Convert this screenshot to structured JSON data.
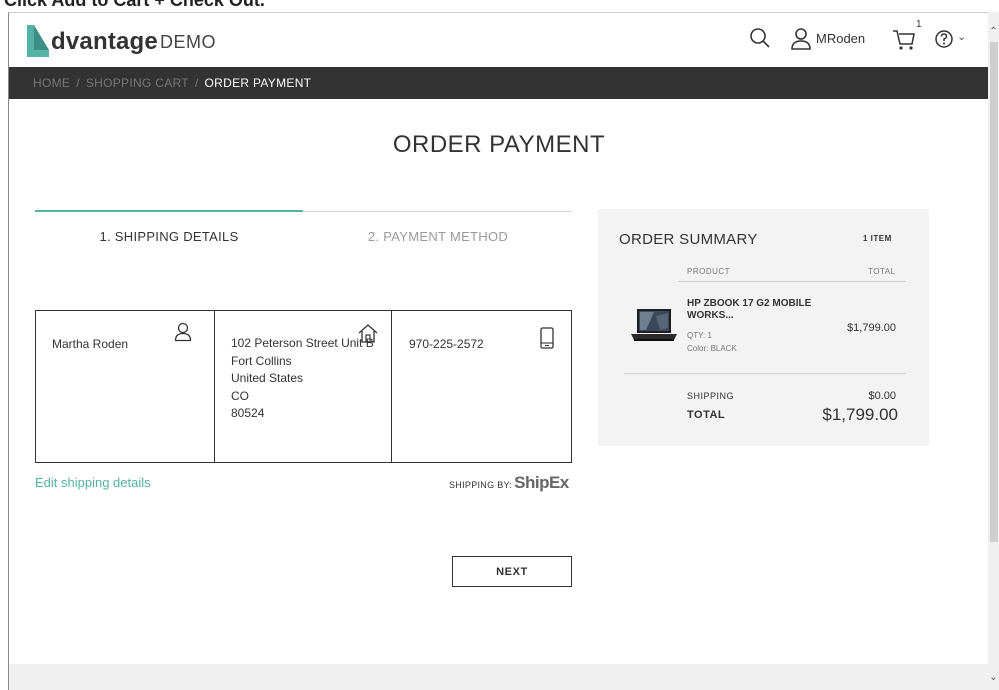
{
  "caption": "Click Add to Cart + Check Out.",
  "header": {
    "logo_word": "dvantage",
    "logo_sub": "DEMO",
    "user_name": "MRoden",
    "cart_count": "1",
    "icons": [
      "search-icon",
      "user-icon",
      "cart-icon",
      "help-icon",
      "chevron-down-icon"
    ]
  },
  "breadcrumb": {
    "home": "HOME",
    "cart": "SHOPPING CART",
    "current": "ORDER PAYMENT"
  },
  "page_title": "ORDER PAYMENT",
  "steps": {
    "step1": "1. SHIPPING DETAILS",
    "step2": "2. PAYMENT METHOD"
  },
  "shipping": {
    "name": "Martha Roden",
    "address_line1": "102 Peterson Street Unit B",
    "city": "Fort Collins",
    "country": "United States",
    "state": "CO",
    "zip": "80524",
    "phone": "970-225-2572",
    "edit_link": "Edit shipping details",
    "ship_by_label": "SHIPPING BY:",
    "ship_by_brand": "ShipEx",
    "next_button": "NEXT"
  },
  "summary": {
    "title": "ORDER SUMMARY",
    "count": "1 ITEM",
    "col_product": "PRODUCT",
    "col_total": "TOTAL",
    "product_name": "HP ZBOOK 17 G2 MOBILE WORKS...",
    "qty": "QTY: 1",
    "color": "Color: BLACK",
    "price": "$1,799.00",
    "shipping_label": "SHIPPING",
    "shipping_value": "$0.00",
    "total_label": "TOTAL",
    "total_value": "$1,799.00"
  },
  "colors": {
    "accent": "#54b2a6",
    "breadcrumb_bg": "#333333",
    "summary_bg": "#f3f3f3"
  }
}
